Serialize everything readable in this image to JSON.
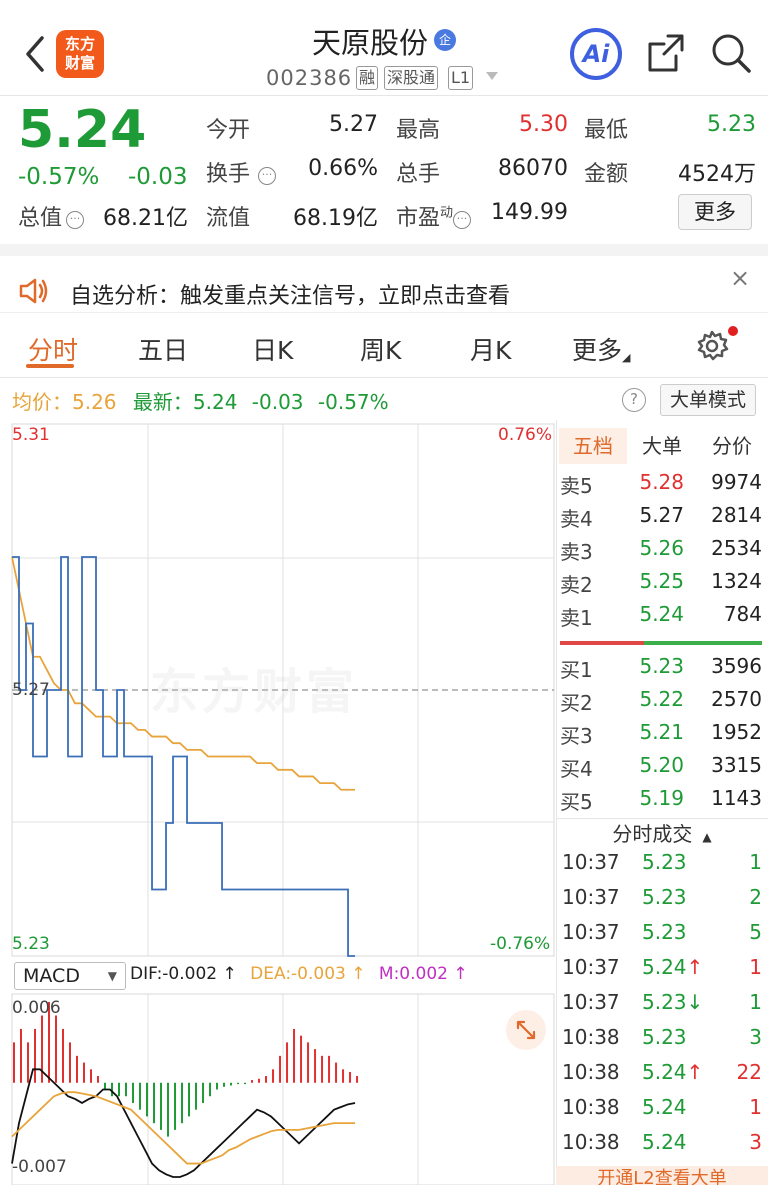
{
  "header": {
    "logo_text": "东方\n财富",
    "title": "天原股份",
    "title_badge": "企",
    "code": "002386",
    "tags": [
      "融",
      "深股通",
      "L1"
    ],
    "ai_label": "Ai"
  },
  "quote": {
    "price": "5.24",
    "change_pct": "-0.57%",
    "change": "-0.03",
    "items": [
      {
        "label": "今开",
        "value": "5.27",
        "color": "#222222"
      },
      {
        "label": "最高",
        "value": "5.30",
        "color": "#e03030"
      },
      {
        "label": "最低",
        "value": "5.23",
        "color": "#1e9a36"
      },
      {
        "label": "换手",
        "value": "0.66%",
        "color": "#222222"
      },
      {
        "label": "总手",
        "value": "86070",
        "color": "#222222"
      },
      {
        "label": "金额",
        "value": "4524万",
        "color": "#222222"
      },
      {
        "label": "总值",
        "value": "68.21亿",
        "color": "#222222"
      },
      {
        "label": "流值",
        "value": "68.19亿",
        "color": "#222222"
      },
      {
        "label": "市盈",
        "label_sup": "动",
        "value": "149.99",
        "color": "#222222"
      }
    ],
    "more_label": "更多"
  },
  "notice": {
    "text": "自选分析：触发重点关注信号，立即点击查看",
    "close": "×"
  },
  "tabs": [
    "分时",
    "五日",
    "日K",
    "周K",
    "月K",
    "更多"
  ],
  "intraday": {
    "avg_label": "均价：",
    "avg_value": "5.26",
    "latest_label": "最新：",
    "latest_value": "5.24",
    "latest_change": "-0.03",
    "latest_pct": "-0.57%",
    "help": "?",
    "big_order_mode": "大单模式",
    "y_top": "5.31",
    "y_mid": "5.27",
    "y_bottom": "5.23",
    "pct_top": "0.76%",
    "pct_bottom": "-0.76%",
    "watermark": "东方财富"
  },
  "macd": {
    "select_label": "MACD",
    "dif": "DIF:-0.002 ↑",
    "dea": "DEA:-0.003 ↑",
    "m": "M:0.002 ↑",
    "y_top": "0.006",
    "y_bottom": "-0.007"
  },
  "chart_data": {
    "type": "line",
    "title": "",
    "price": {
      "ylim": [
        5.23,
        5.31
      ],
      "prev_close": 5.27,
      "series": [
        {
          "name": "均价",
          "color": "#e8a43a",
          "values": [
            5.29,
            5.285,
            5.28,
            5.275,
            5.275,
            5.273,
            5.271,
            5.27,
            5.27,
            5.268,
            5.268,
            5.267,
            5.266,
            5.266,
            5.266,
            5.265,
            5.265,
            5.265,
            5.264,
            5.264,
            5.263,
            5.263,
            5.263,
            5.262,
            5.262,
            5.261,
            5.261,
            5.261,
            5.26,
            5.26,
            5.26,
            5.26,
            5.26,
            5.26,
            5.26,
            5.259,
            5.259,
            5.259,
            5.258,
            5.258,
            5.258,
            5.257,
            5.257,
            5.257,
            5.256,
            5.256,
            5.256,
            5.255,
            5.255,
            5.255
          ]
        },
        {
          "values": [
            5.29,
            5.27,
            5.28,
            5.26,
            5.26,
            5.27,
            5.27,
            5.29,
            5.26,
            5.26,
            5.29,
            5.29,
            5.27,
            5.26,
            5.26,
            5.27,
            5.26,
            5.26,
            5.26,
            5.26,
            5.24,
            5.24,
            5.25,
            5.26,
            5.26,
            5.25,
            5.25,
            5.25,
            5.25,
            5.25,
            5.24,
            5.24,
            5.24,
            5.24,
            5.24,
            5.24,
            5.24,
            5.24,
            5.24,
            5.24,
            5.24,
            5.24,
            5.24,
            5.24,
            5.24,
            5.24,
            5.24,
            5.24,
            5.23,
            5.23
          ]
        }
      ]
    },
    "macd": {
      "ylim": [
        -0.007,
        0.006
      ],
      "hist": [
        0.003,
        0.004,
        0.003,
        0.004,
        0.005,
        0.006,
        0.005,
        0.004,
        0.003,
        0.002,
        0.0015,
        0.001,
        0.0005,
        -0.0005,
        -0.001,
        -0.001,
        -0.001,
        -0.0015,
        -0.002,
        -0.0025,
        -0.003,
        -0.0035,
        -0.004,
        -0.0035,
        -0.003,
        -0.0025,
        -0.002,
        -0.0015,
        -0.001,
        -0.0005,
        -0.0003,
        -0.0002,
        -0.0001,
        -0.0001,
        0.0002,
        0.0003,
        0.0005,
        0.001,
        0.002,
        0.003,
        0.004,
        0.0035,
        0.003,
        0.0025,
        0.002,
        0.002,
        0.0015,
        0.001,
        0.0008,
        0.0005
      ],
      "dif": [
        -0.006,
        -0.003,
        -0.001,
        0.001,
        0.001,
        0.0005,
        0,
        -0.0005,
        -0.001,
        -0.0012,
        -0.0015,
        -0.0012,
        -0.001,
        -0.0005,
        -0.0005,
        -0.001,
        -0.002,
        -0.003,
        -0.004,
        -0.005,
        -0.006,
        -0.0065,
        -0.0068,
        -0.007,
        -0.007,
        -0.0068,
        -0.0065,
        -0.006,
        -0.0055,
        -0.005,
        -0.0045,
        -0.004,
        -0.0035,
        -0.003,
        -0.0025,
        -0.002,
        -0.0022,
        -0.0025,
        -0.003,
        -0.0035,
        -0.004,
        -0.0045,
        -0.004,
        -0.0035,
        -0.003,
        -0.0025,
        -0.002,
        -0.0018,
        -0.0016,
        -0.0015
      ],
      "dea": [
        -0.004,
        -0.0035,
        -0.003,
        -0.0025,
        -0.002,
        -0.0015,
        -0.001,
        -0.0008,
        -0.0007,
        -0.0007,
        -0.0008,
        -0.0009,
        -0.001,
        -0.0012,
        -0.0014,
        -0.0016,
        -0.0018,
        -0.002,
        -0.0025,
        -0.003,
        -0.0035,
        -0.004,
        -0.0045,
        -0.005,
        -0.0055,
        -0.006,
        -0.006,
        -0.006,
        -0.0058,
        -0.0056,
        -0.0054,
        -0.005,
        -0.0048,
        -0.0045,
        -0.0042,
        -0.004,
        -0.0038,
        -0.0036,
        -0.0035,
        -0.0035,
        -0.0035,
        -0.0035,
        -0.0034,
        -0.0033,
        -0.0032,
        -0.0031,
        -0.003,
        -0.003,
        -0.003,
        -0.003
      ]
    }
  },
  "orderbook": {
    "tabs": [
      "五档",
      "大单",
      "分价"
    ],
    "asks": [
      {
        "label": "卖5",
        "price": "5.28",
        "vol": "9974",
        "color": "#e03030"
      },
      {
        "label": "卖4",
        "price": "5.27",
        "vol": "2814",
        "color": "#222222"
      },
      {
        "label": "卖3",
        "price": "5.26",
        "vol": "2534",
        "color": "#1e9a36"
      },
      {
        "label": "卖2",
        "price": "5.25",
        "vol": "1324",
        "color": "#1e9a36"
      },
      {
        "label": "卖1",
        "price": "5.24",
        "vol": "784",
        "color": "#1e9a36"
      }
    ],
    "bids": [
      {
        "label": "买1",
        "price": "5.23",
        "vol": "3596",
        "color": "#1e9a36"
      },
      {
        "label": "买2",
        "price": "5.22",
        "vol": "2570",
        "color": "#1e9a36"
      },
      {
        "label": "买3",
        "price": "5.21",
        "vol": "1952",
        "color": "#1e9a36"
      },
      {
        "label": "买4",
        "price": "5.20",
        "vol": "3315",
        "color": "#1e9a36"
      },
      {
        "label": "买5",
        "price": "5.19",
        "vol": "1143",
        "color": "#1e9a36"
      }
    ],
    "ticks_title": "分时成交",
    "ticks": [
      {
        "time": "10:37",
        "price": "5.23",
        "arrow": "",
        "vol": "1",
        "vcolor": "#1e9a36"
      },
      {
        "time": "10:37",
        "price": "5.23",
        "arrow": "",
        "vol": "2",
        "vcolor": "#1e9a36"
      },
      {
        "time": "10:37",
        "price": "5.23",
        "arrow": "",
        "vol": "5",
        "vcolor": "#1e9a36"
      },
      {
        "time": "10:37",
        "price": "5.24",
        "arrow": "↑",
        "vol": "1",
        "vcolor": "#e03030"
      },
      {
        "time": "10:37",
        "price": "5.23",
        "arrow": "↓",
        "vol": "1",
        "vcolor": "#1e9a36"
      },
      {
        "time": "10:38",
        "price": "5.23",
        "arrow": "",
        "vol": "3",
        "vcolor": "#1e9a36"
      },
      {
        "time": "10:38",
        "price": "5.24",
        "arrow": "↑",
        "vol": "22",
        "vcolor": "#e03030"
      },
      {
        "time": "10:38",
        "price": "5.24",
        "arrow": "",
        "vol": "1",
        "vcolor": "#e03030"
      },
      {
        "time": "10:38",
        "price": "5.24",
        "arrow": "",
        "vol": "3",
        "vcolor": "#e03030"
      }
    ],
    "open_l2": "开通L2查看大单"
  },
  "colors": {
    "up": "#e03030",
    "down": "#1e9a36",
    "avg": "#e8a43a",
    "price_line": "#3a6fb8",
    "accent": "#e06a2a"
  }
}
